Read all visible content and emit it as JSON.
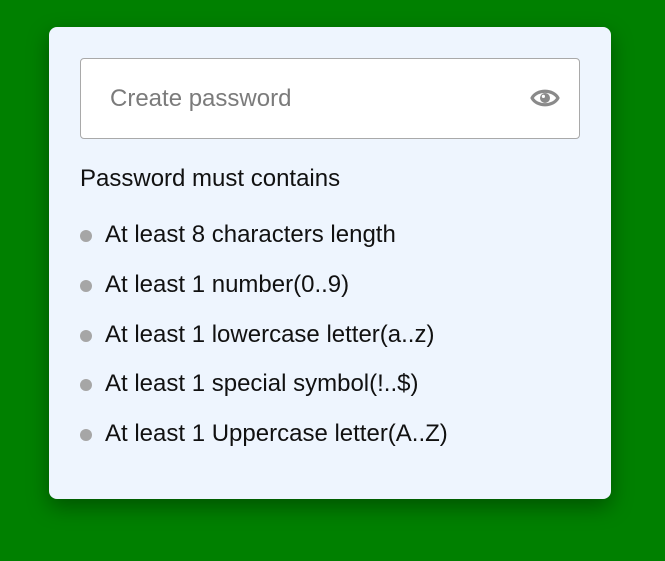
{
  "form": {
    "password_placeholder": "Create password",
    "password_value": "",
    "toggle_icon": "eye-icon"
  },
  "requirements": {
    "heading": "Password must contains",
    "items": [
      {
        "label": "At least 8 characters length",
        "met": false
      },
      {
        "label": "At least 1 number(0..9)",
        "met": false
      },
      {
        "label": "At least 1 lowercase letter(a..z)",
        "met": false
      },
      {
        "label": "At least 1 special symbol(!..$)",
        "met": false
      },
      {
        "label": "At least 1 Uppercase letter(A..Z)",
        "met": false
      }
    ]
  },
  "colors": {
    "background": "#008000",
    "card": "#eef5fe",
    "unmet_dot": "#a6a6a6",
    "icon": "#8a8a8a"
  }
}
